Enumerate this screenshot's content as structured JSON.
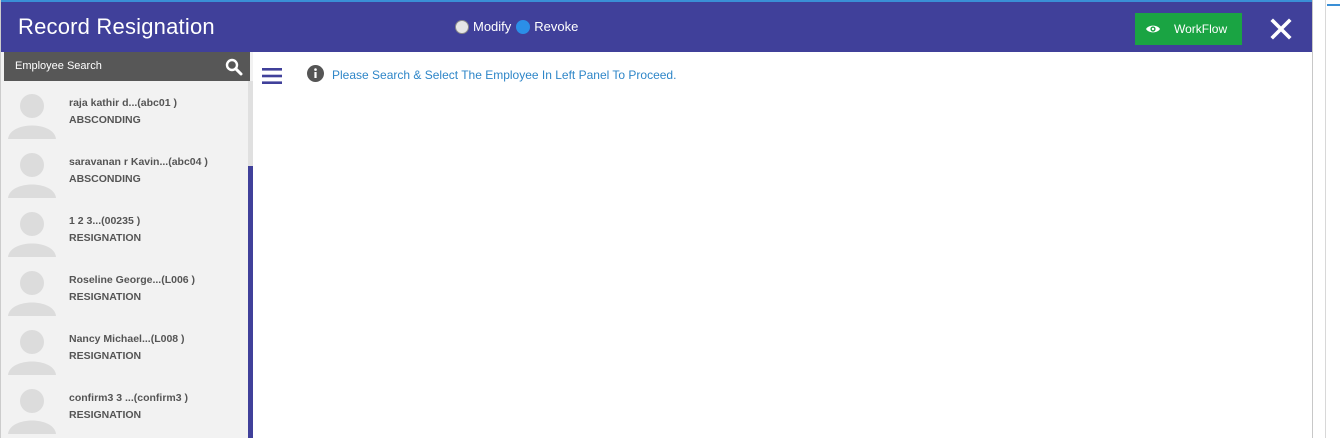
{
  "header": {
    "title": "Record Resignation",
    "mode_options": [
      {
        "label": "Modify",
        "selected": false
      },
      {
        "label": "Revoke",
        "selected": true
      }
    ],
    "workflow_label": "WorkFlow",
    "workflow_icon": "eye-icon",
    "close_icon": "close-icon",
    "colors": {
      "header_bg": "#40409a",
      "workflow_bg": "#1aa443",
      "radio_selected": "#2b8fe8"
    }
  },
  "sidebar": {
    "search_label": "Employee Search",
    "search_icon": "search-icon",
    "employees": [
      {
        "name": "raja kathir d...(abc01 )",
        "status": "ABSCONDING"
      },
      {
        "name": "saravanan r Kavin...(abc04 )",
        "status": "ABSCONDING"
      },
      {
        "name": "1 2 3...(00235 )",
        "status": "RESIGNATION"
      },
      {
        "name": "Roseline George...(L006 )",
        "status": "RESIGNATION"
      },
      {
        "name": "Nancy Michael...(L008 )",
        "status": "RESIGNATION"
      },
      {
        "name": "confirm3 3 ...(confirm3 )",
        "status": "RESIGNATION"
      }
    ]
  },
  "main": {
    "menu_icon": "hamburger-menu-icon",
    "info_icon": "info-icon",
    "message": "Please Search & Select The Employee In Left Panel To Proceed.",
    "message_color": "#2e86c8"
  }
}
